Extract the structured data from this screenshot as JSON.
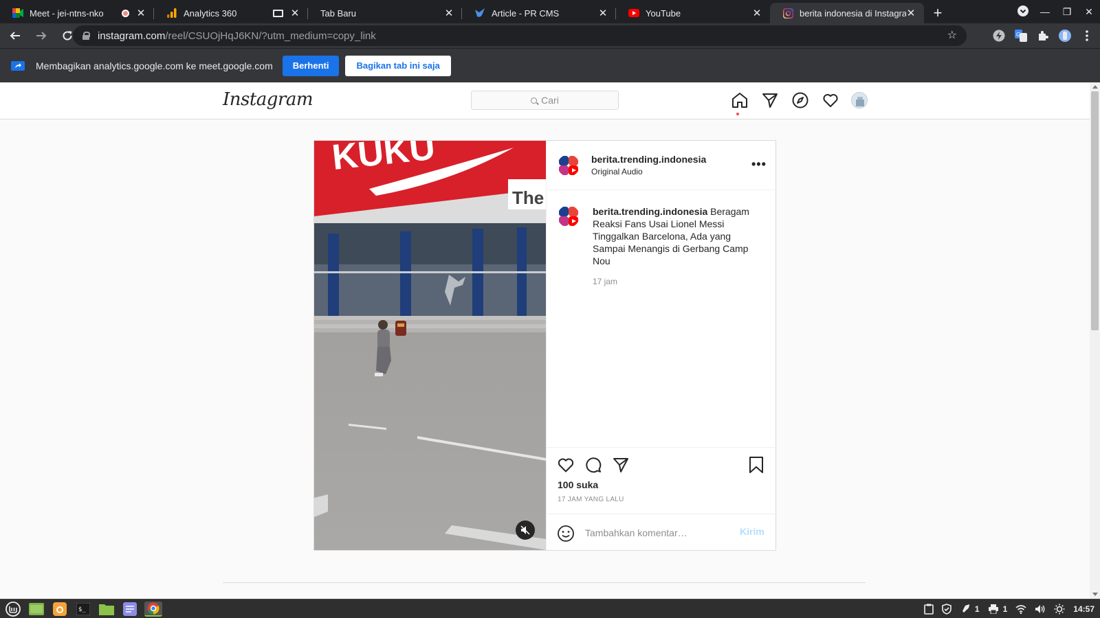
{
  "browser": {
    "tabs": [
      {
        "title": "Meet - jei-ntns-nko",
        "favicon": "google-meet-icon",
        "recording": true,
        "active": false
      },
      {
        "title": "Analytics 360",
        "favicon": "analytics-icon",
        "casting": true,
        "active": false
      },
      {
        "title": "Tab Baru",
        "favicon": "",
        "active": false
      },
      {
        "title": "Article - PR CMS",
        "favicon": "pr-cms-bird-icon",
        "active": false
      },
      {
        "title": "YouTube",
        "favicon": "youtube-icon",
        "active": false
      },
      {
        "title": "berita indonesia di Instagram",
        "favicon": "instagram-icon",
        "active": true
      }
    ],
    "url_host": "instagram.com",
    "url_path": "/reel/CSUOjHqJ6KN/?utm_medium=copy_link"
  },
  "share_bar": {
    "message": "Membagikan analytics.google.com ke meet.google.com",
    "stop_label": "Berhenti",
    "share_this_tab_label": "Bagikan tab ini saja"
  },
  "instagram": {
    "logo": "Instagram",
    "search_placeholder": "Cari",
    "post": {
      "username": "berita.trending.indonesia",
      "audio": "Original Audio",
      "caption_user": "berita.trending.indonesia",
      "caption_text": "Beragam Reaksi Fans Usai Lionel Messi Tinggalkan Barcelona, Ada yang Sampai Menangis di Gerbang Camp Nou",
      "caption_time": "17 jam",
      "likes": "100 suka",
      "time_ago": "17 JAM YANG LALU",
      "comment_placeholder": "Tambahkan komentar…",
      "post_button": "Kirim",
      "video_text": "The",
      "video_banner_text": "KUKU"
    }
  },
  "taskbar": {
    "tray_count_1": "1",
    "tray_count_2": "1",
    "clock": "14:57"
  },
  "colors": {
    "chrome_dark": "#202124",
    "chrome_toolbar": "#35363a",
    "accent_blue": "#1a73e8",
    "instagram_link": "#b2dffc"
  }
}
